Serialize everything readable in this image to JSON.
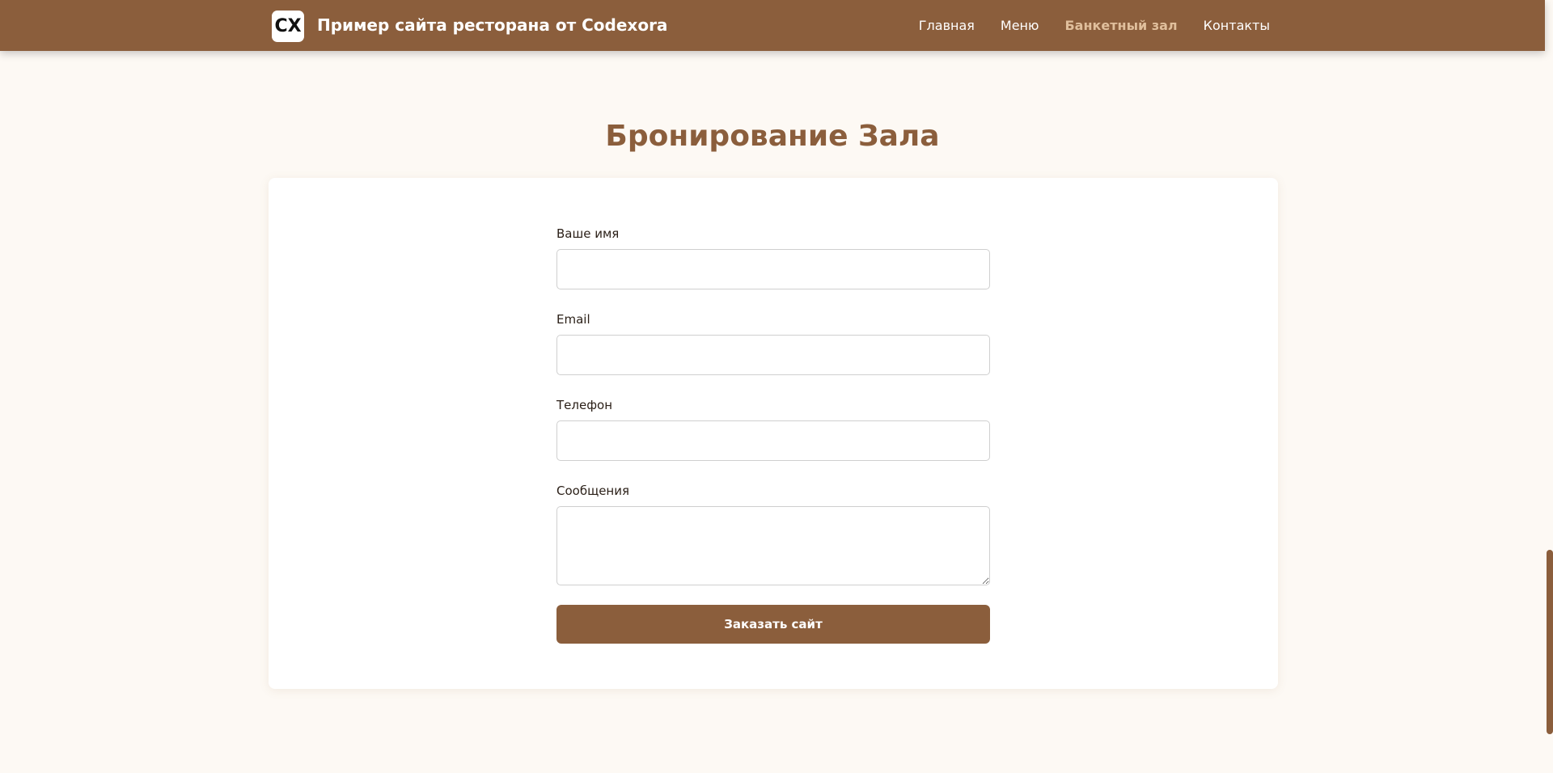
{
  "header": {
    "logo_text": "CX",
    "site_title": "Пример сайта ресторана от Codexora",
    "nav": [
      {
        "label": "Главная",
        "active": false
      },
      {
        "label": "Меню",
        "active": false
      },
      {
        "label": "Банкетный зал",
        "active": true
      },
      {
        "label": "Контакты",
        "active": false
      }
    ]
  },
  "main": {
    "heading": "Бронирование Зала",
    "form": {
      "name_label": "Ваше имя",
      "name_value": "",
      "name_placeholder": "",
      "email_label": "Email",
      "email_value": "",
      "email_placeholder": "",
      "phone_label": "Телефон",
      "phone_value": "",
      "phone_placeholder": "",
      "message_label": "Сообщения",
      "message_value": "",
      "message_placeholder": "",
      "submit_label": "Заказать сайт"
    }
  },
  "colors": {
    "brand": "#8b5e3c",
    "active_nav": "#e0bf9c",
    "page_bg": "#fdf9f4"
  }
}
